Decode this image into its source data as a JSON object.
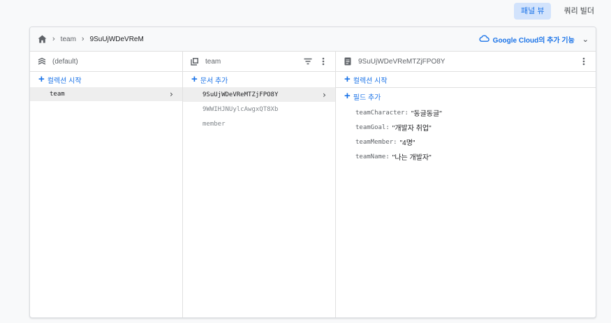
{
  "view_toggle": {
    "panel_view": "패널 뷰",
    "query_builder": "쿼리 빌더"
  },
  "breadcrumb": {
    "collection": "team",
    "document": "9SuUjWDeVReM"
  },
  "google_cloud": {
    "label": "Google Cloud의 추가 기능"
  },
  "col1": {
    "title": "(default)",
    "add_label": "컬렉션 시작",
    "items": [
      {
        "label": "team"
      }
    ]
  },
  "col2": {
    "title": "team",
    "add_label": "문서 추가",
    "items": [
      {
        "label": "9SuUjWDeVReMTZjFPO8Y"
      },
      {
        "label": "9WWIHJNUylcAwgxQT8Xb"
      },
      {
        "label": "member"
      }
    ]
  },
  "col3": {
    "title": "9SuUjWDeVReMTZjFPO8Y",
    "add_collection_label": "컬렉션 시작",
    "add_field_label": "필드 추가",
    "fields": [
      {
        "key": "teamCharacter:",
        "value": "\"동글동글\""
      },
      {
        "key": "teamGoal:",
        "value": "\"개발자 취업\""
      },
      {
        "key": "teamMember:",
        "value": "\"4명\""
      },
      {
        "key": "teamName:",
        "value": "\"나는 개발자\""
      }
    ]
  },
  "colors": {
    "accent": "#1a73e8",
    "selected_bg": "#eeeeee",
    "toggle_bg": "#d2e3fc"
  }
}
